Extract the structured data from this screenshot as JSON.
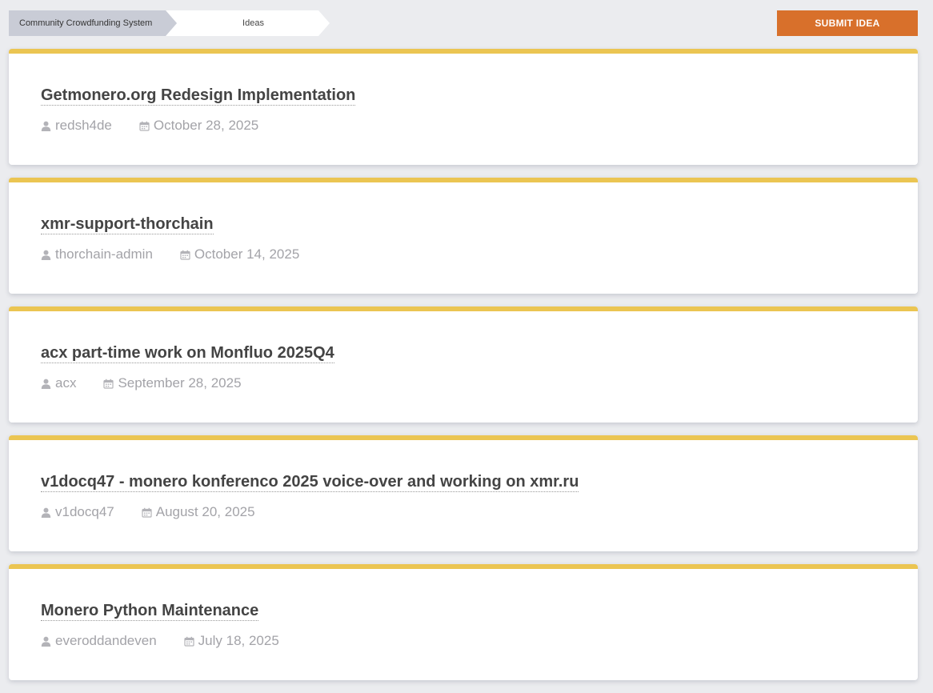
{
  "breadcrumb": {
    "items": [
      {
        "label": "Community Crowdfunding System"
      },
      {
        "label": "Ideas"
      }
    ]
  },
  "actions": {
    "submit_label": "SUBMIT IDEA"
  },
  "colors": {
    "accent_orange": "#d8702b",
    "card_top_border": "#ebc552",
    "page_background": "#ebecef",
    "meta_text": "#a3a3a8"
  },
  "icons": {
    "author": "user-icon",
    "date": "calendar-icon"
  },
  "ideas": [
    {
      "title": "Getmonero.org Redesign Implementation",
      "author": "redsh4de",
      "date": "October 28, 2025"
    },
    {
      "title": "xmr-support-thorchain",
      "author": "thorchain-admin",
      "date": "October 14, 2025"
    },
    {
      "title": "acx part-time work on Monfluo 2025Q4",
      "author": "acx",
      "date": "September 28, 2025"
    },
    {
      "title": "v1docq47 - monero konferenco 2025 voice-over and working on xmr.ru",
      "author": "v1docq47",
      "date": "August 20, 2025"
    },
    {
      "title": "Monero Python Maintenance",
      "author": "everoddandeven",
      "date": "July 18, 2025"
    }
  ]
}
